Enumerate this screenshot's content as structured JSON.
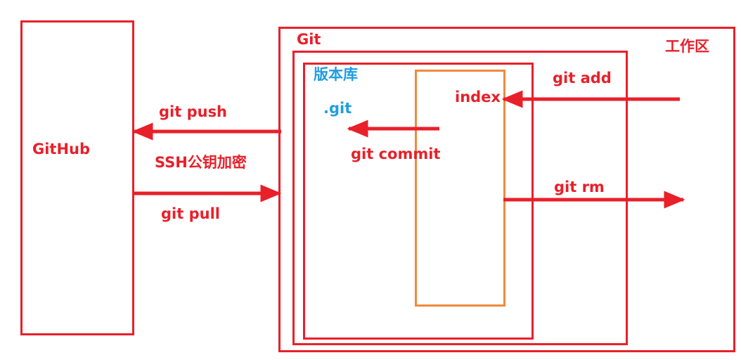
{
  "boxes": {
    "github": "GitHub",
    "git": "Git",
    "workspace": "工作区",
    "repository": "版本库",
    "dotgit": ".git",
    "index": "index"
  },
  "arrows": {
    "push": "git push",
    "ssh": "SSH公钥加密",
    "pull": "git pull",
    "add": "git add",
    "commit": "git commit",
    "rm": "git rm"
  },
  "colors": {
    "main": "#e8202a",
    "index_box": "#f08a3c",
    "blue_text": "#1f9ee0"
  }
}
